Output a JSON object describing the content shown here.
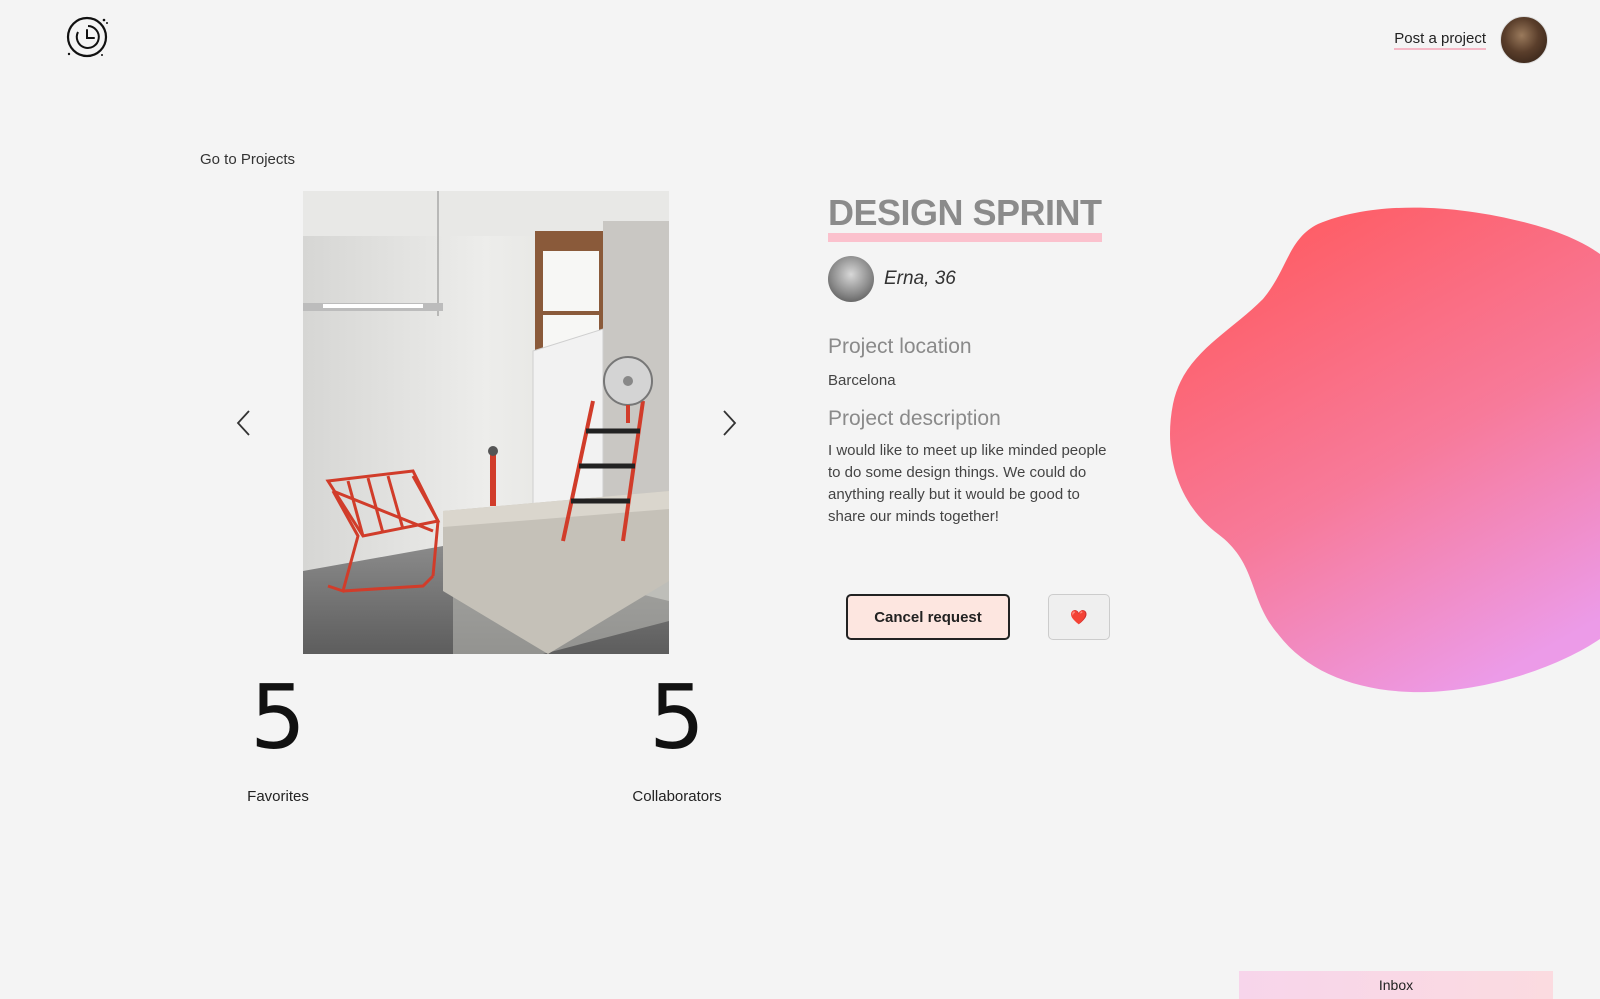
{
  "header": {
    "post_project_label": "Post a project"
  },
  "nav": {
    "back_label": "Go to Projects"
  },
  "project": {
    "title": "DESIGN SPRINT",
    "owner": "Erna, 36",
    "location_heading": "Project location",
    "location": "Barcelona",
    "description_heading": "Project description",
    "description": "I would like to meet up like minded people to do some design things. We could do anything really but it would be good to share our minds together!"
  },
  "stats": {
    "favorites_count": "5",
    "favorites_label": "Favorites",
    "collaborators_count": "5",
    "collaborators_label": "Collaborators"
  },
  "actions": {
    "cancel_label": "Cancel request",
    "favorite_icon": "❤️"
  },
  "footer": {
    "inbox_label": "Inbox"
  },
  "colors": {
    "accent_pink": "#fbc1cd",
    "blob_top": "#ff5a5f",
    "blob_bottom": "#ec9be8",
    "cancel_bg": "#fde6e0"
  }
}
